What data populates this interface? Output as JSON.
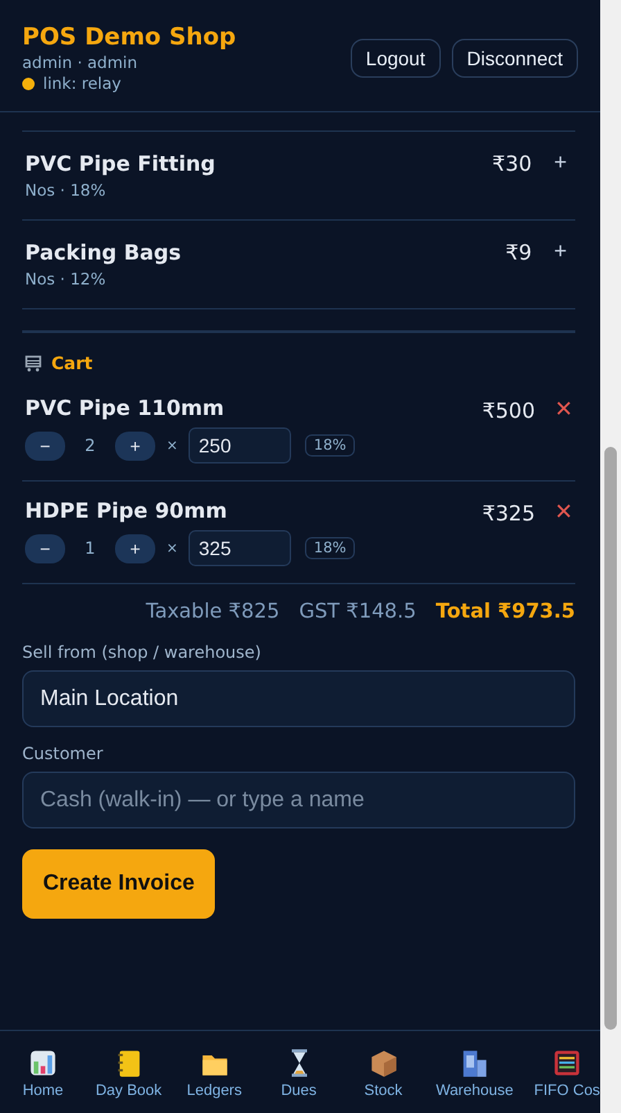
{
  "header": {
    "title": "POS Demo Shop",
    "user": "admin · admin",
    "link_status": {
      "label": "link: relay",
      "color": "#f5b00b"
    },
    "buttons": [
      "Logout",
      "Disconnect"
    ]
  },
  "products": [
    {
      "name": "PVC Pipe Fitting",
      "meta": "Nos · 18%",
      "price": "₹30",
      "add": "+"
    },
    {
      "name": "Packing Bags",
      "meta": "Nos · 12%",
      "price": "₹9",
      "add": "+"
    }
  ],
  "cart": {
    "title": "Cart",
    "items": [
      {
        "name": "PVC Pipe 110mm",
        "minus": "−",
        "qty": "2",
        "plus": "+",
        "times": "×",
        "rate": "250",
        "gst": "18%",
        "amount": "₹500",
        "remove": "✕"
      },
      {
        "name": "HDPE Pipe 90mm",
        "minus": "−",
        "qty": "1",
        "plus": "+",
        "times": "×",
        "rate": "325",
        "gst": "18%",
        "amount": "₹325",
        "remove": "✕"
      }
    ],
    "totals": {
      "taxable": "Taxable ₹825",
      "gst": "GST ₹148.5",
      "total": "Total ₹973.5"
    }
  },
  "sell_from": {
    "label": "Sell from (shop / warehouse)",
    "value": "Main Location"
  },
  "customer": {
    "label": "Customer",
    "placeholder": "Cash (walk-in) — or type a name"
  },
  "create_button": "Create Invoice",
  "nav": [
    {
      "kind": "chart",
      "label": "Home"
    },
    {
      "kind": "notebook",
      "label": "Day Book"
    },
    {
      "kind": "folder",
      "label": "Ledgers"
    },
    {
      "kind": "hourglass",
      "label": "Dues"
    },
    {
      "kind": "box",
      "label": "Stock"
    },
    {
      "kind": "building",
      "label": "Warehouse"
    },
    {
      "kind": "abacus",
      "label": "FIFO Cos"
    }
  ]
}
